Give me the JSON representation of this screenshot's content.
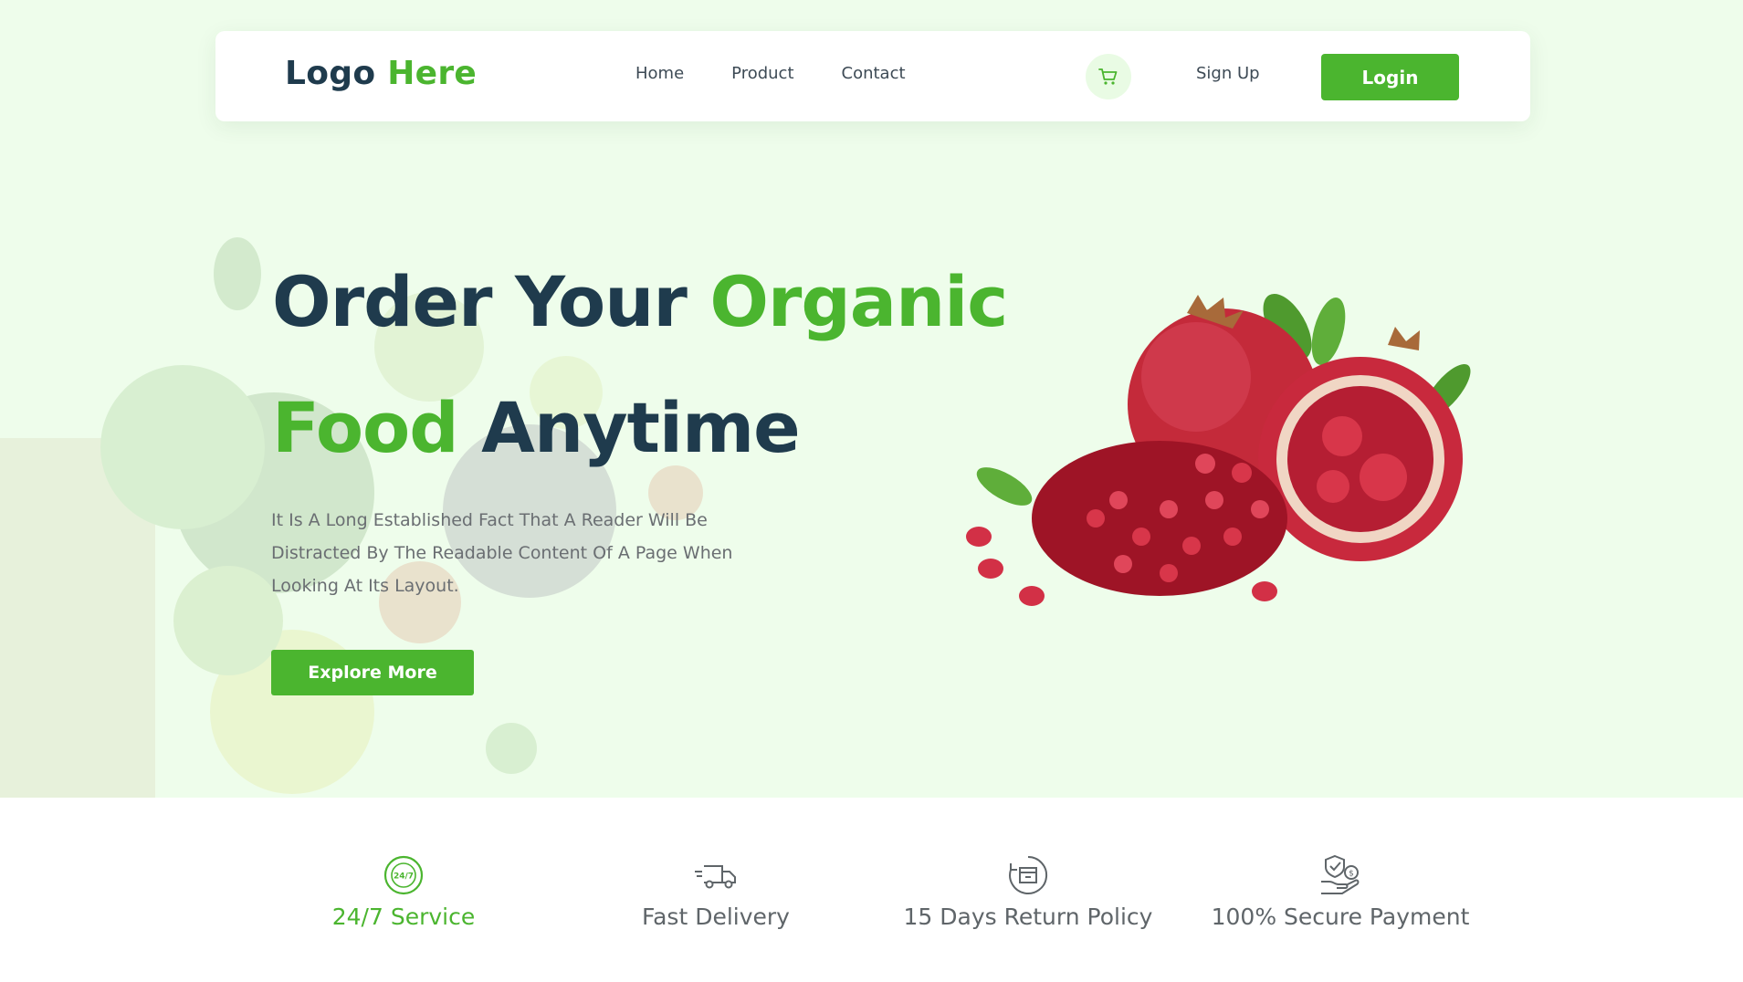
{
  "nav": {
    "logo_part1": "Logo",
    "logo_part2": "Here",
    "links": [
      "Home",
      "Product",
      "Contact"
    ],
    "cart_icon": "cart-icon",
    "signup_label": "Sign Up",
    "login_label": "Login"
  },
  "hero": {
    "line1_dark": "Order Your",
    "line1_green": "Organic",
    "line2_green": "Food",
    "line2_dark": "Anytime",
    "description": "It Is A Long Established Fact That A Reader Will Be Distracted By The Readable Content Of A Page When Looking At Its Layout.",
    "cta_label": "Explore More"
  },
  "features": [
    {
      "label": "24/7 Service",
      "icon": "clock-24-7-icon",
      "badge": "24/7"
    },
    {
      "label": "Fast Delivery",
      "icon": "delivery-truck-icon"
    },
    {
      "label": "15 Days Return Policy",
      "icon": "return-box-icon"
    },
    {
      "label": "100% Secure Payment",
      "icon": "secure-payment-icon"
    }
  ],
  "colors": {
    "accent": "#4bb52f",
    "dark": "#1f3b4d",
    "hero_bg": "#eefdeb"
  }
}
